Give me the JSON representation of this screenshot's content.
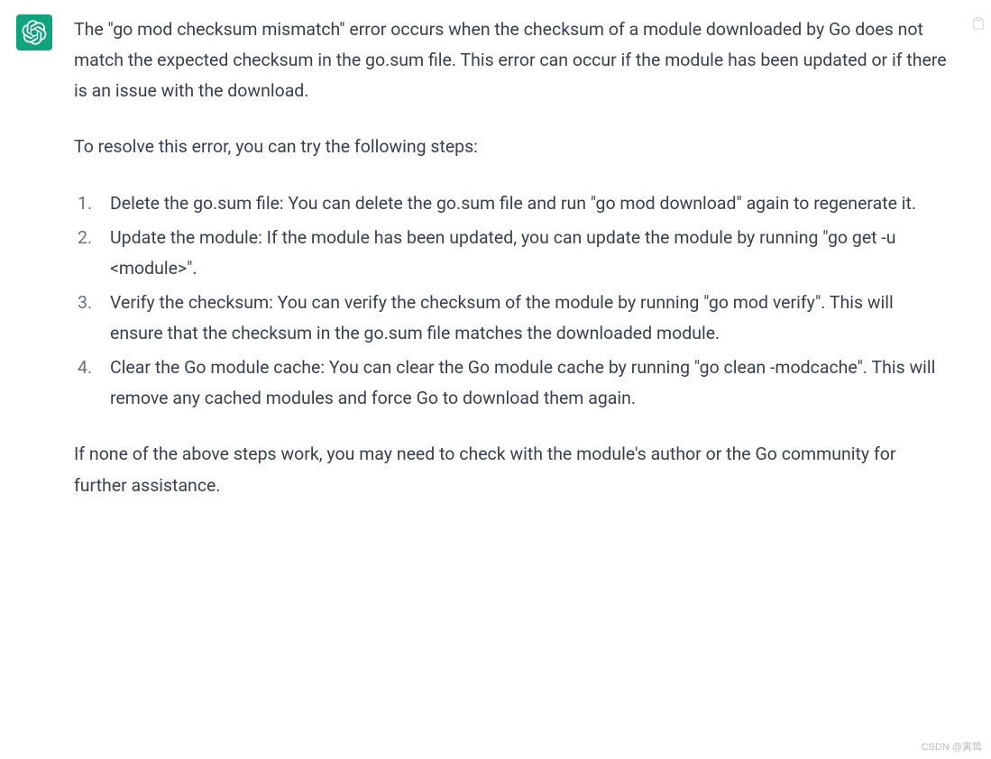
{
  "message": {
    "intro": "The \"go mod checksum mismatch\" error occurs when the checksum of a module downloaded by Go does not match the expected checksum in the go.sum file. This error can occur if the module has been updated or if there is an issue with the download.",
    "stepsIntro": "To resolve this error, you can try the following steps:",
    "steps": [
      "Delete the go.sum file: You can delete the go.sum file and run \"go mod download\" again to regenerate it.",
      "Update the module: If the module has been updated, you can update the module by running \"go get -u <module>\".",
      "Verify the checksum: You can verify the checksum of the module by running \"go mod verify\". This will ensure that the checksum in the go.sum file matches the downloaded module.",
      "Clear the Go module cache: You can clear the Go module cache by running \"go clean -modcache\". This will remove any cached modules and force Go to download them again."
    ],
    "outro": "If none of the above steps work, you may need to check with the module's author or the Go community for further assistance."
  },
  "watermark": "CSDN @寅鸷"
}
